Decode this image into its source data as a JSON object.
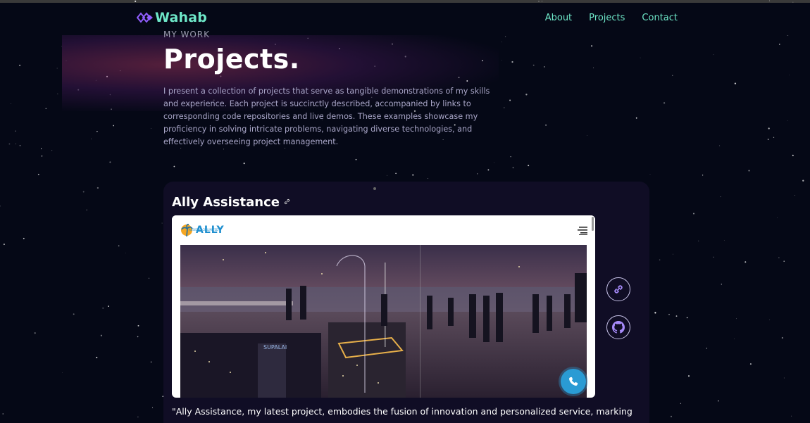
{
  "nav": {
    "logo_text": "Wahab",
    "links": [
      "About",
      "Projects",
      "Contact"
    ]
  },
  "header": {
    "subtitle": "MY WORK",
    "title": "Projects.",
    "intro": "I present a collection of projects that serve as tangible demonstrations of my skills and experience. Each project is succinctly described, accompanied by links to corresponding code repositories and live demos. These examples showcase my proficiency in solving intricate problems, navigating diverse technologies, and effectively overseeing project management."
  },
  "project": {
    "title": "Ally Assistance",
    "title_link_icon": "link-icon",
    "preview_brand": "ALLY",
    "preview_brand_sub": "ASSISTANCE LIMITED",
    "description": "\"Ally Assistance, my latest project, embodies the fusion of innovation and personalized service, marking"
  },
  "icons": {
    "live_link": "link-icon",
    "github": "github-icon",
    "phone": "phone-icon"
  },
  "colors": {
    "background": "#050816",
    "accent": "#6ee7c8",
    "card": "#100d25",
    "logo_purple": "#915eff"
  }
}
